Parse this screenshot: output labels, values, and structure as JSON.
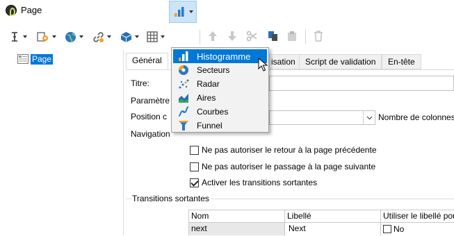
{
  "window": {
    "title": "Page"
  },
  "toolbar": {
    "buttons": [
      {
        "icon": "text-cursor-icon"
      },
      {
        "icon": "gear-add-icon"
      },
      {
        "icon": "globe-icon"
      },
      {
        "icon": "link-icon"
      },
      {
        "icon": "cube-icon"
      },
      {
        "icon": "table-icon"
      },
      {
        "icon": "bar-chart-icon"
      },
      {
        "icon": "arrow-up-icon"
      },
      {
        "icon": "arrow-down-icon"
      },
      {
        "icon": "cut-icon"
      },
      {
        "icon": "copy-icon"
      },
      {
        "icon": "paste-icon"
      },
      {
        "icon": "trash-icon"
      }
    ]
  },
  "tree": {
    "item_label": "Page"
  },
  "tabs": [
    {
      "label": "Général"
    },
    {
      "label": "isation"
    },
    {
      "label": "Script de validation"
    },
    {
      "label": "En-tête"
    }
  ],
  "form": {
    "title_label": "Titre:",
    "params_label": "Paramètre",
    "position_label": "Position c",
    "columns_label": "Nombre de colonnes",
    "navigation_label": "Navigation"
  },
  "checkboxes": [
    {
      "label": "Ne pas autoriser le retour à la page précédente",
      "checked": false
    },
    {
      "label": "Ne pas autoriser le passage à la page suivante",
      "checked": false
    },
    {
      "label": "Activer les transitions sortantes",
      "checked": true
    }
  ],
  "transitions": {
    "group_label": "Transitions sortantes",
    "columns": [
      "Nom",
      "Libellé",
      "Utiliser le libellé pou"
    ],
    "rows": [
      {
        "name": "next",
        "label": "Next",
        "use_label": "No",
        "use_label_checked": false
      }
    ]
  },
  "chart_menu": {
    "items": [
      {
        "label": "Histogramme",
        "icon": "histogram-icon",
        "highlighted": true
      },
      {
        "label": "Secteurs",
        "icon": "pie-chart-icon",
        "highlighted": false
      },
      {
        "label": "Radar",
        "icon": "radar-icon",
        "highlighted": false
      },
      {
        "label": "Aires",
        "icon": "area-chart-icon",
        "highlighted": false
      },
      {
        "label": "Courbes",
        "icon": "line-chart-icon",
        "highlighted": false
      },
      {
        "label": "Funnel",
        "icon": "funnel-icon",
        "highlighted": false
      }
    ]
  },
  "colors": {
    "selection": "#0078d7",
    "active_button": "#cce4f7",
    "menu_bg": "#f2f2f2"
  }
}
